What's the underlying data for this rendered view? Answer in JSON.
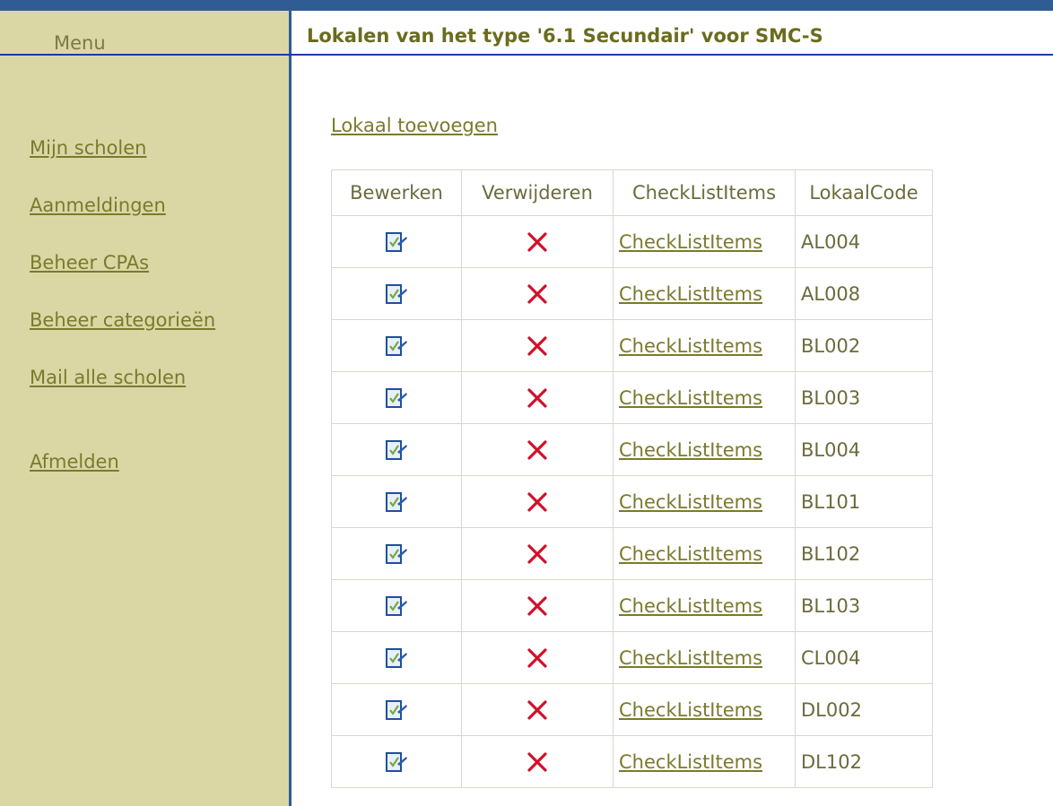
{
  "colors": {
    "topbar": "#2f5d93",
    "sidebar": "#dad7a5",
    "link": "#7b7a2c",
    "title": "#6b6b1f",
    "delete_red": "#d0112b",
    "edit_blue": "#2a5fb0"
  },
  "sidebar": {
    "menu_title": "Menu",
    "items": [
      {
        "label": "Mijn scholen"
      },
      {
        "label": "Aanmeldingen"
      },
      {
        "label": "Beheer CPAs"
      },
      {
        "label": "Beheer categorieën"
      },
      {
        "label": "Mail alle scholen"
      },
      {
        "label": "Afmelden"
      }
    ]
  },
  "main": {
    "title": "Lokalen van het type '6.1 Secundair' voor SMC-S",
    "add_link": "Lokaal toevoegen",
    "columns": [
      "Bewerken",
      "Verwijderen",
      "CheckListItems",
      "LokaalCode"
    ],
    "rows": [
      {
        "edit_icon": "edit-icon",
        "delete_icon": "delete-icon",
        "link": "CheckListItems",
        "code": "AL004"
      },
      {
        "edit_icon": "edit-icon",
        "delete_icon": "delete-icon",
        "link": "CheckListItems",
        "code": "AL008"
      },
      {
        "edit_icon": "edit-icon",
        "delete_icon": "delete-icon",
        "link": "CheckListItems",
        "code": "BL002"
      },
      {
        "edit_icon": "edit-icon",
        "delete_icon": "delete-icon",
        "link": "CheckListItems",
        "code": "BL003"
      },
      {
        "edit_icon": "edit-icon",
        "delete_icon": "delete-icon",
        "link": "CheckListItems",
        "code": "BL004"
      },
      {
        "edit_icon": "edit-icon",
        "delete_icon": "delete-icon",
        "link": "CheckListItems",
        "code": "BL101"
      },
      {
        "edit_icon": "edit-icon",
        "delete_icon": "delete-icon",
        "link": "CheckListItems",
        "code": "BL102"
      },
      {
        "edit_icon": "edit-icon",
        "delete_icon": "delete-icon",
        "link": "CheckListItems",
        "code": "BL103"
      },
      {
        "edit_icon": "edit-icon",
        "delete_icon": "delete-icon",
        "link": "CheckListItems",
        "code": "CL004"
      },
      {
        "edit_icon": "edit-icon",
        "delete_icon": "delete-icon",
        "link": "CheckListItems",
        "code": "DL002"
      },
      {
        "edit_icon": "edit-icon",
        "delete_icon": "delete-icon",
        "link": "CheckListItems",
        "code": "DL102"
      }
    ]
  }
}
